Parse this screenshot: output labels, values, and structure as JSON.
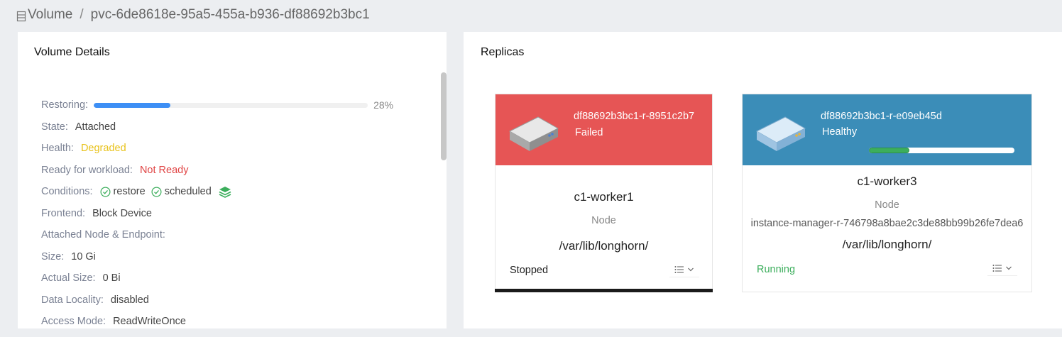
{
  "breadcrumb": {
    "root": "Volume",
    "separator": "/",
    "current": "pvc-6de8618e-95a5-455a-b936-df88692b3bc1"
  },
  "details": {
    "title": "Volume Details",
    "restoring_label": "Restoring:",
    "restoring_progress": 0.28,
    "restoring_pct": "28%",
    "state_label": "State:",
    "state": "Attached",
    "health_label": "Health:",
    "health": "Degraded",
    "workload_label": "Ready for workload:",
    "workload": "Not Ready",
    "conditions_label": "Conditions:",
    "conditions": [
      "restore",
      "scheduled"
    ],
    "frontend_label": "Frontend:",
    "frontend": "Block Device",
    "attached_label": "Attached Node & Endpoint:",
    "size_label": "Size:",
    "size": "10 Gi",
    "actual_size_label": "Actual Size:",
    "actual_size": "0 Bi",
    "locality_label": "Data Locality:",
    "locality": "disabled",
    "access_label": "Access Mode:",
    "access": "ReadWriteOnce"
  },
  "replicas": {
    "title": "Replicas",
    "items": [
      {
        "name": "df88692b3bc1-r-8951c2b7",
        "mode": "Failed",
        "node": "c1-worker1",
        "node_label": "Node",
        "instance_manager": "",
        "path": "/var/lib/longhorn/",
        "status": "Stopped",
        "header_color": "#e65555"
      },
      {
        "name": "df88692b3bc1-r-e09eb45d",
        "mode": "Healthy",
        "rebuild_progress": 0.28,
        "node": "c1-worker3",
        "node_label": "Node",
        "instance_manager": "instance-manager-r-746798a8bae2c3de88bb99b26fe7dea6",
        "path": "/var/lib/longhorn/",
        "status": "Running",
        "header_color": "#3b8db8"
      }
    ]
  },
  "colors": {
    "progress": "#3d8ff5",
    "warning": "#e8c21a",
    "error": "#e04444",
    "success": "#3cae5c"
  }
}
